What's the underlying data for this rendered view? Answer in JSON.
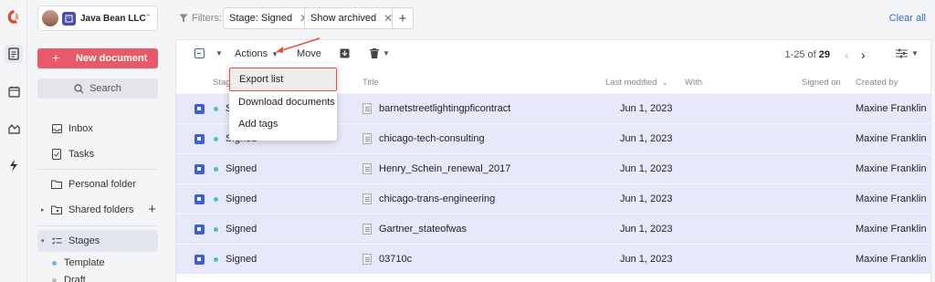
{
  "org": {
    "name": "Java Bean LLC"
  },
  "sidebar": {
    "new_document": "New document",
    "search": "Search",
    "items": [
      {
        "label": "Inbox"
      },
      {
        "label": "Tasks"
      },
      {
        "label": "Personal folder"
      },
      {
        "label": "Shared folders"
      },
      {
        "label": "Stages"
      }
    ],
    "stages": [
      {
        "label": "Template"
      },
      {
        "label": "Draft"
      }
    ]
  },
  "filters": {
    "label": "Filters:",
    "chips": [
      {
        "label": "Stage: Signed"
      },
      {
        "label": "Show archived"
      }
    ],
    "add": "+",
    "clear_all": "Clear all"
  },
  "toolbar": {
    "actions": "Actions",
    "move": "Move",
    "pagination": {
      "range": "1-25 of",
      "total": "29"
    }
  },
  "menu": {
    "items": [
      "Export list",
      "Download documents",
      "Add tags"
    ]
  },
  "table": {
    "headers": {
      "stage": "Stag",
      "title": "Title",
      "last_modified": "Last modified",
      "with": "With",
      "signed_on": "Signed on",
      "created_by": "Created by"
    },
    "rows": [
      {
        "stage": "Si",
        "title": "barnetstreetlightingpficontract",
        "modified": "Jun 1, 2023",
        "created_by": "Maxine Franklin"
      },
      {
        "stage": "Signed",
        "title": "chicago-tech-consulting",
        "modified": "Jun 1, 2023",
        "created_by": "Maxine Franklin"
      },
      {
        "stage": "Signed",
        "title": "Henry_Schein_renewal_2017",
        "modified": "Jun 1, 2023",
        "created_by": "Maxine Franklin"
      },
      {
        "stage": "Signed",
        "title": "chicago-trans-engineering",
        "modified": "Jun 1, 2023",
        "created_by": "Maxine Franklin"
      },
      {
        "stage": "Signed",
        "title": "Gartner_stateofwas",
        "modified": "Jun 1, 2023",
        "created_by": "Maxine Franklin"
      },
      {
        "stage": "Signed",
        "title": "03710c",
        "modified": "Jun 1, 2023",
        "created_by": "Maxine Franklin"
      }
    ]
  },
  "colors": {
    "accent": "#e85a6a",
    "link": "#2f6bd6",
    "selected_row": "#e7e9fb",
    "signed_dot": "#4ac4b8",
    "highlight": "#e0533b"
  }
}
